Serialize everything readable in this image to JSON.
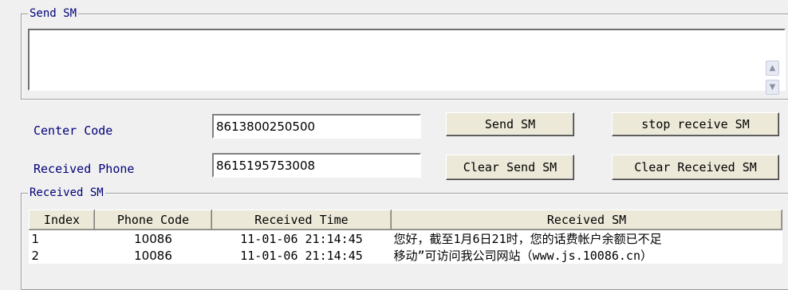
{
  "send_group": {
    "legend": "Send SM",
    "message_value": "",
    "scroll_up_icon": "scroll-up-arrow",
    "scroll_down_icon": "scroll-down-arrow"
  },
  "center_code": {
    "label": "Center Code",
    "value": "8613800250500"
  },
  "received_phone": {
    "label": "Received Phone",
    "value": "8615195753008"
  },
  "buttons": {
    "send": "Send SM",
    "stop_receive": "stop receive SM",
    "clear_send": "Clear Send SM",
    "clear_received": "Clear Received SM"
  },
  "received_group": {
    "legend": "Received SM",
    "columns": [
      "Index",
      "Phone Code",
      "Received Time",
      "Received SM"
    ],
    "rows": [
      {
        "index": "1",
        "phone": "10086",
        "time": "11-01-06 21:14:45",
        "sm": "您好，截至1月6日21时，您的话费帐户余额已不足"
      },
      {
        "index": "2",
        "phone": "10086",
        "time": "11-01-06 21:14:45",
        "sm": "移动”可访问我公司网站（www.js.10086.cn）"
      }
    ]
  },
  "colors": {
    "label_blue": "#00007a",
    "window_bg": "#f0f0f0",
    "button_face": "#ece9d8"
  }
}
